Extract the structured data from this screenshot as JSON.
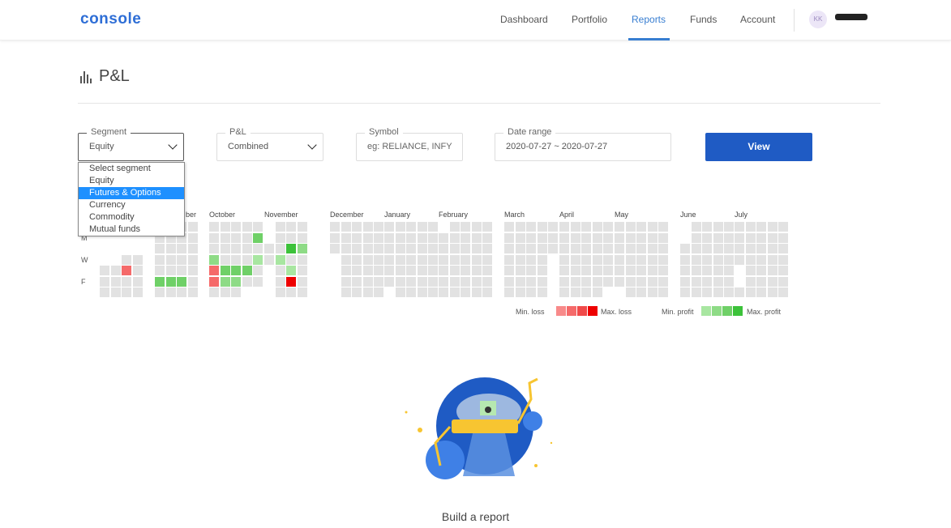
{
  "app": {
    "logo": "console",
    "nav": [
      {
        "label": "Dashboard"
      },
      {
        "label": "Portfolio"
      },
      {
        "label": "Reports"
      },
      {
        "label": "Funds"
      },
      {
        "label": "Account"
      }
    ],
    "active_nav": "Reports",
    "avatar_initials": "KK"
  },
  "page": {
    "title": "P&L"
  },
  "filters": {
    "segment": {
      "label": "Segment",
      "value": "Equity"
    },
    "pnl": {
      "label": "P&L",
      "value": "Combined"
    },
    "symbol": {
      "label": "Symbol",
      "placeholder": "eg: RELIANCE, INFY"
    },
    "date_range": {
      "label": "Date range",
      "value": "2020-07-27 ~ 2020-07-27"
    },
    "view_button": "View"
  },
  "segment_dropdown": {
    "options": [
      "Select segment",
      "Equity",
      "Futures & Options",
      "Currency",
      "Commodity",
      "Mutual funds"
    ],
    "highlighted": "Futures & Options"
  },
  "heatmap": {
    "months": [
      "ber",
      "October",
      "November",
      "December",
      "January",
      "February",
      "March",
      "April",
      "May",
      "June",
      "July"
    ],
    "day_labels": [
      "M",
      "W",
      "F"
    ],
    "legend": {
      "min_loss": "Min. loss",
      "max_loss": "Max. loss",
      "min_profit": "Min. profit",
      "max_profit": "Max. profit",
      "loss_colors": [
        "#f88a8a",
        "#f56a6a",
        "#f04a4a",
        "#ee0000"
      ],
      "profit_colors": [
        "#a8e6a1",
        "#8edb86",
        "#6fd067",
        "#3cc23a"
      ]
    },
    "colors": {
      "empty": "#e2e2e2"
    }
  },
  "empty_state": {
    "text": "Build a report"
  }
}
